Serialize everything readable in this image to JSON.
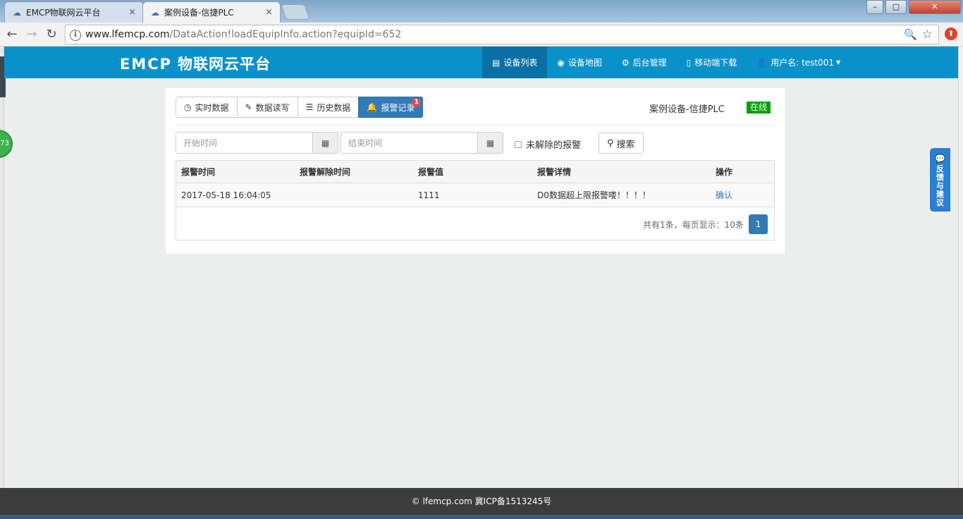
{
  "browser": {
    "tabs": [
      {
        "title": "EMCP物联网云平台",
        "close": "×"
      },
      {
        "title": "案例设备-信捷PLC",
        "close": "×"
      }
    ],
    "url_host": "www.lfemcp.com",
    "url_path": "/DataAction!loadEquipInfo.action?equipId=652",
    "window_controls": [
      "–",
      "□",
      "✕"
    ]
  },
  "navbar": {
    "brand_logo": "EMCP",
    "brand_text": "物联网云平台",
    "items": [
      {
        "label": "设备列表",
        "icon": "list-icon"
      },
      {
        "label": "设备地图",
        "icon": "globe-icon"
      },
      {
        "label": "后台管理",
        "icon": "cogs-icon"
      },
      {
        "label": "移动端下载",
        "icon": "phone-icon"
      },
      {
        "label": "用户名: test001",
        "icon": "user-icon"
      }
    ]
  },
  "side_badge": "73",
  "tabs": [
    {
      "label": "实时数据",
      "icon": "clock-icon"
    },
    {
      "label": "数据读写",
      "icon": "pencil-icon"
    },
    {
      "label": "历史数据",
      "icon": "list-icon"
    },
    {
      "label": "报警记录",
      "icon": "bell-icon",
      "badge": "1"
    }
  ],
  "device": {
    "name": "案例设备-信捷PLC",
    "status": "在线",
    "status_color": "#08a20a"
  },
  "filters": {
    "start_placeholder": "开始时间",
    "end_placeholder": "结束时间",
    "unresolved_label": "未解除的报警",
    "search_label": "搜索"
  },
  "table": {
    "headers": [
      "报警时间",
      "报警解除时间",
      "报警值",
      "报警详情",
      "操作"
    ],
    "rows": [
      {
        "time": "2017-05-18 16:04:05",
        "resolved_time": "",
        "value": "1111",
        "detail": "D0数据超上限报警喽！！！！",
        "action": "确认"
      }
    ]
  },
  "pagination": {
    "info": "共有1条，每页显示：10条",
    "current_page": "1"
  },
  "feedback": {
    "label": "反馈与建议"
  },
  "footer": {
    "text": "lfemcp.com 冀ICP备1513245号"
  },
  "colors": {
    "navbar": "#0b91c9",
    "navbar_active": "#0a6fa4",
    "primary": "#337ab7",
    "footer": "#3c3c3c"
  }
}
